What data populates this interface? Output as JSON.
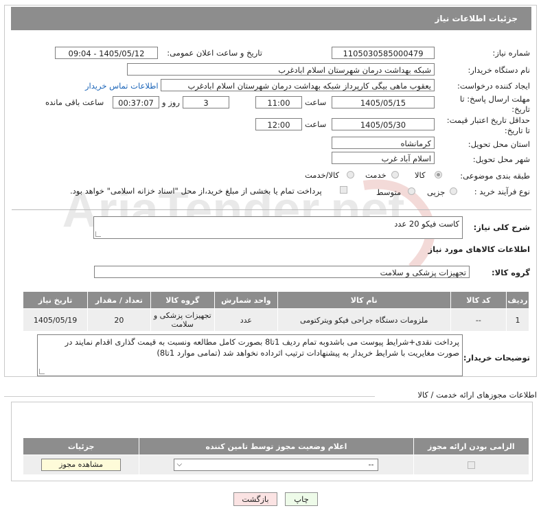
{
  "header": {
    "title": "جزئیات اطلاعات نیاز"
  },
  "form": {
    "need_number_label": "شماره نیاز:",
    "need_number": "1105030585000479",
    "announce_label": "تاریخ و ساعت اعلان عمومی:",
    "announce_value": "1405/05/12 - 09:04",
    "buyer_org_label": "نام دستگاه خریدار:",
    "buyer_org": "شبکه بهداشت درمان شهرستان اسلام ابادغرب",
    "creator_label": "ایجاد کننده درخواست:",
    "creator": "یعقوب ماهی بیگی کارپرداز شبکه بهداشت درمان شهرستان اسلام ابادغرب",
    "contact_link": "اطلاعات تماس خریدار",
    "deadline_label_1": "مهلت ارسال پاسخ: تا",
    "deadline_label_2": "تاریخ:",
    "deadline_date": "1405/05/15",
    "time_label": "ساعت",
    "deadline_time": "11:00",
    "days_value": "3",
    "days_label": "روز و",
    "remaining_time": "00:37:07",
    "remaining_label": "ساعت باقی مانده",
    "min_price_label_1": "حداقل تاریخ اعتبار قیمت:",
    "min_price_label_2": "تا تاریخ:",
    "price_date": "1405/05/30",
    "price_time": "12:00",
    "province_label": "استان محل تحویل:",
    "province": "کرمانشاه",
    "city_label": "شهر محل تحویل:",
    "city": "اسلام آباد غرب",
    "category_label": "طبقه بندی موضوعی:",
    "category_options": [
      "کالا",
      "خدمت",
      "کالا/خدمت"
    ],
    "process_label": "نوع فرآیند خرید :",
    "process_options": [
      "جزیی",
      "متوسط"
    ],
    "payment_note": "پرداخت تمام یا بخشی از مبلغ خرید،از محل \"اسناد خزانه اسلامی\" خواهد بود."
  },
  "description": {
    "label": "شرح کلی نیاز:",
    "value": "کاست فیکو 20 عدد"
  },
  "goods_info_title": "اطلاعات کالاهای مورد نیاز",
  "goods_group": {
    "label": "گروه کالا:",
    "value": "تجهیزات پزشکی و سلامت"
  },
  "goods_table": {
    "headers": [
      "ردیف",
      "کد کالا",
      "نام کالا",
      "واحد شمارش",
      "گروه کالا",
      "تعداد / مقدار",
      "تاریخ نیاز"
    ],
    "rows": [
      [
        "1",
        "--",
        "ملزومات دستگاه جراحی فیکو ویترکتومی",
        "عدد",
        "تجهیزات پزشکی و سلامت",
        "20",
        "1405/05/19"
      ]
    ]
  },
  "buyer_notes": {
    "label": "توضیحات خریدار:",
    "value": "پرداخت نقدی+شرایط پیوست می باشدوبه تمام ردیف 1تا8 بصورت کامل مطالعه ونسبت به قیمت گذاری اقدام نمایند در صورت مغایریت با شرایط خریدار به پیشنهادات ترتیب اثرداده نخواهد شد (تمامی موارد 1تا8)"
  },
  "permits": {
    "title": "اطلاعات مجوزهای ارائه خدمت / کالا",
    "headers": [
      "الزامی بودن ارائه مجوز",
      "اعلام وضعیت مجوز توسط تامین کننده",
      "جزئیات"
    ],
    "select_value": "--",
    "view_button": "مشاهده مجوز"
  },
  "footer": {
    "print_label": "چاپ",
    "back_label": "بازگشت"
  },
  "watermark": {
    "text": "AriaTender.net",
    "color": "#c0392b"
  }
}
